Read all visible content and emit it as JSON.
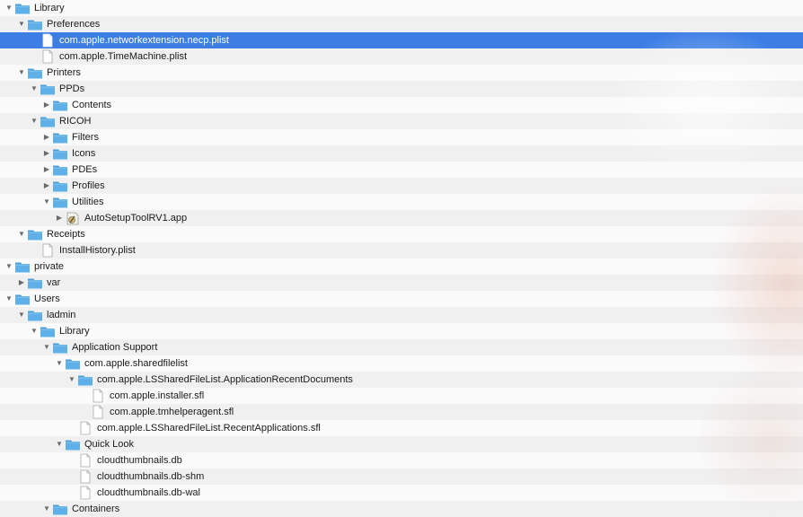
{
  "tree": {
    "rows": [
      {
        "label": "Library",
        "type": "folder",
        "level": 0,
        "disclosure": "open"
      },
      {
        "label": "Preferences",
        "type": "folder",
        "level": 1,
        "disclosure": "open"
      },
      {
        "label": "com.apple.networkextension.necp.plist",
        "type": "file",
        "level": 2,
        "disclosure": "none",
        "selected": true
      },
      {
        "label": "com.apple.TimeMachine.plist",
        "type": "file",
        "level": 2,
        "disclosure": "none"
      },
      {
        "label": "Printers",
        "type": "folder",
        "level": 1,
        "disclosure": "open"
      },
      {
        "label": "PPDs",
        "type": "folder",
        "level": 2,
        "disclosure": "open"
      },
      {
        "label": "Contents",
        "type": "folder",
        "level": 3,
        "disclosure": "closed"
      },
      {
        "label": "RICOH",
        "type": "folder",
        "level": 2,
        "disclosure": "open"
      },
      {
        "label": "Filters",
        "type": "folder",
        "level": 3,
        "disclosure": "closed"
      },
      {
        "label": "Icons",
        "type": "folder",
        "level": 3,
        "disclosure": "closed"
      },
      {
        "label": "PDEs",
        "type": "folder",
        "level": 3,
        "disclosure": "closed"
      },
      {
        "label": "Profiles",
        "type": "folder",
        "level": 3,
        "disclosure": "closed"
      },
      {
        "label": "Utilities",
        "type": "folder",
        "level": 3,
        "disclosure": "open"
      },
      {
        "label": "AutoSetupToolRV1.app",
        "type": "app",
        "level": 4,
        "disclosure": "closed"
      },
      {
        "label": "Receipts",
        "type": "folder",
        "level": 1,
        "disclosure": "open"
      },
      {
        "label": "InstallHistory.plist",
        "type": "file",
        "level": 2,
        "disclosure": "none"
      },
      {
        "label": "private",
        "type": "folder",
        "level": 0,
        "disclosure": "open"
      },
      {
        "label": "var",
        "type": "folder",
        "level": 1,
        "disclosure": "closed"
      },
      {
        "label": "Users",
        "type": "folder",
        "level": 0,
        "disclosure": "open"
      },
      {
        "label": "ladmin",
        "type": "folder",
        "level": 1,
        "disclosure": "open"
      },
      {
        "label": "Library",
        "type": "folder",
        "level": 2,
        "disclosure": "open"
      },
      {
        "label": "Application Support",
        "type": "folder",
        "level": 3,
        "disclosure": "open"
      },
      {
        "label": "com.apple.sharedfilelist",
        "type": "folder",
        "level": 4,
        "disclosure": "open"
      },
      {
        "label": "com.apple.LSSharedFileList.ApplicationRecentDocuments",
        "type": "folder",
        "level": 5,
        "disclosure": "open"
      },
      {
        "label": "com.apple.installer.sfl",
        "type": "file",
        "level": 6,
        "disclosure": "none"
      },
      {
        "label": "com.apple.tmhelperagent.sfl",
        "type": "file",
        "level": 6,
        "disclosure": "none"
      },
      {
        "label": "com.apple.LSSharedFileList.RecentApplications.sfl",
        "type": "file",
        "level": 5,
        "disclosure": "none"
      },
      {
        "label": "Quick Look",
        "type": "folder",
        "level": 4,
        "disclosure": "open"
      },
      {
        "label": "cloudthumbnails.db",
        "type": "file",
        "level": 5,
        "disclosure": "none"
      },
      {
        "label": "cloudthumbnails.db-shm",
        "type": "file",
        "level": 5,
        "disclosure": "none"
      },
      {
        "label": "cloudthumbnails.db-wal",
        "type": "file",
        "level": 5,
        "disclosure": "none"
      },
      {
        "label": "Containers",
        "type": "folder",
        "level": 3,
        "disclosure": "open"
      }
    ]
  },
  "icons": {
    "folder": "folder-icon",
    "file": "document-icon",
    "app": "application-icon",
    "open": "disclosure-triangle-down-icon",
    "closed": "disclosure-triangle-right-icon"
  },
  "colors": {
    "selection": "#3d7ee5",
    "folder_body": "#5fb0e8",
    "folder_tab": "#4a9ed9"
  }
}
